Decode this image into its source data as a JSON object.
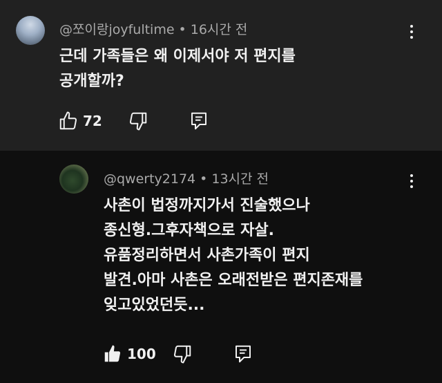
{
  "comments": [
    {
      "username": "@쪼이랑joyfultime",
      "separator": "•",
      "time": "16시간 전",
      "lines": [
        "근데 가족들은 왜 이제서야 저 편지를",
        "공개할까?"
      ],
      "likes": "72",
      "liked": false,
      "avatar_icon": "avatar-user-joyfultime",
      "bg": "#212121"
    },
    {
      "username": "@qwerty2174",
      "separator": "•",
      "time": "13시간 전",
      "lines": [
        "사촌이 법정까지가서 진술했으나",
        "종신형.그후자책으로 자살.",
        "유품정리하면서 사촌가족이 편지",
        "발견.아마 사촌은 오래전받은 편지존재를",
        "잊고있었던듯..."
      ],
      "likes": "100",
      "liked": true,
      "avatar_icon": "avatar-user-qwerty2174",
      "bg": "#0f0f0f"
    }
  ],
  "icons": {
    "like": "thumbs-up-icon",
    "dislike": "thumbs-down-icon",
    "reply": "reply-comment-icon",
    "more": "more-vert-icon"
  },
  "colors": {
    "text": "#f1f1f1",
    "meta": "#aaaaaa"
  }
}
